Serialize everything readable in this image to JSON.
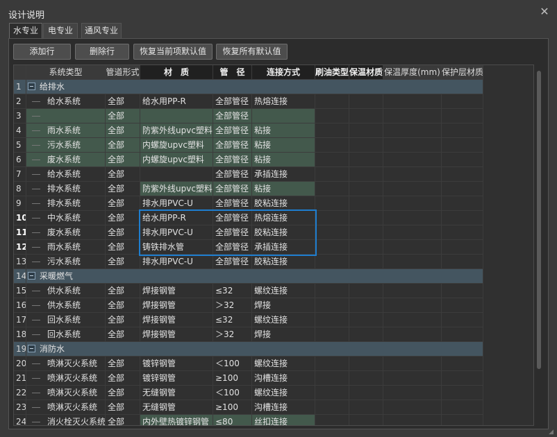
{
  "window": {
    "title": "设计说明",
    "close_glyph": "✕"
  },
  "tabs": [
    {
      "label": "水专业",
      "active": true
    },
    {
      "label": "电专业",
      "active": false
    },
    {
      "label": "通风专业",
      "active": false
    }
  ],
  "toolbar": {
    "add_label": "添加行",
    "delete_label": "删除行",
    "restore_current_label": "恢复当前项默认值",
    "restore_all_label": "恢复所有默认值"
  },
  "columns": [
    "系统类型",
    "管道形式",
    "材　质",
    "管　径",
    "连接方式",
    "刷油类型",
    "保温材质",
    "保温厚度(mm)",
    "保护层材质"
  ],
  "rows": [
    {
      "num": "1",
      "group": true,
      "name": "给排水"
    },
    {
      "num": "2",
      "cells": [
        "给水系统",
        "全部",
        "给水用PP-R",
        "全部管径",
        "热熔连接"
      ]
    },
    {
      "num": "3",
      "cells": [
        "",
        "全部",
        "",
        "全部管径",
        ""
      ]
    },
    {
      "num": "4",
      "cells": [
        "雨水系统",
        "全部",
        "防紫外线upvc塑料",
        "全部管径",
        "粘接"
      ]
    },
    {
      "num": "5",
      "cells": [
        "污水系统",
        "全部",
        "内螺旋upvc塑料",
        "全部管径",
        "粘接"
      ]
    },
    {
      "num": "6",
      "cells": [
        "废水系统",
        "全部",
        "内螺旋upvc塑料",
        "全部管径",
        "粘接"
      ]
    },
    {
      "num": "7",
      "cells": [
        "给水系统",
        "全部",
        "",
        "全部管径",
        "承插连接"
      ]
    },
    {
      "num": "8",
      "cells": [
        "排水系统",
        "全部",
        "防紫外线upvc塑料",
        "全部管径",
        "粘接"
      ]
    },
    {
      "num": "9",
      "cells": [
        "排水系统",
        "全部",
        "排水用PVC-U",
        "全部管径",
        "胶粘连接"
      ]
    },
    {
      "num": "10",
      "cells": [
        "中水系统",
        "全部",
        "给水用PP-R",
        "全部管径",
        "热熔连接"
      ]
    },
    {
      "num": "11",
      "cells": [
        "废水系统",
        "全部",
        "排水用PVC-U",
        "全部管径",
        "胶粘连接"
      ]
    },
    {
      "num": "12",
      "cells": [
        "雨水系统",
        "全部",
        "铸铁排水管",
        "全部管径",
        "承插连接"
      ]
    },
    {
      "num": "13",
      "cells": [
        "污水系统",
        "全部",
        "排水用PVC-U",
        "全部管径",
        "胶粘连接"
      ]
    },
    {
      "num": "14",
      "group": true,
      "name": "采暖燃气"
    },
    {
      "num": "15",
      "cells": [
        "供水系统",
        "全部",
        "焊接钢管",
        "≤32",
        "螺纹连接"
      ]
    },
    {
      "num": "16",
      "cells": [
        "供水系统",
        "全部",
        "焊接钢管",
        "＞32",
        "焊接"
      ]
    },
    {
      "num": "17",
      "cells": [
        "回水系统",
        "全部",
        "焊接钢管",
        "≤32",
        "螺纹连接"
      ]
    },
    {
      "num": "18",
      "cells": [
        "回水系统",
        "全部",
        "焊接钢管",
        "＞32",
        "焊接"
      ]
    },
    {
      "num": "19",
      "group": true,
      "name": "消防水"
    },
    {
      "num": "20",
      "cells": [
        "喷淋灭火系统",
        "全部",
        "镀锌钢管",
        "＜100",
        "螺纹连接"
      ]
    },
    {
      "num": "21",
      "cells": [
        "喷淋灭火系统",
        "全部",
        "镀锌钢管",
        "≥100",
        "沟槽连接"
      ]
    },
    {
      "num": "22",
      "cells": [
        "喷淋灭火系统",
        "全部",
        "无缝钢管",
        "＜100",
        "螺纹连接"
      ]
    },
    {
      "num": "23",
      "cells": [
        "喷淋灭火系统",
        "全部",
        "无缝钢管",
        "≥100",
        "沟槽连接"
      ]
    },
    {
      "num": "24",
      "cells": [
        "消火栓灭火系统",
        "全部",
        "内外壁热镀锌钢管",
        "≤80",
        "丝扣连接"
      ]
    }
  ]
}
